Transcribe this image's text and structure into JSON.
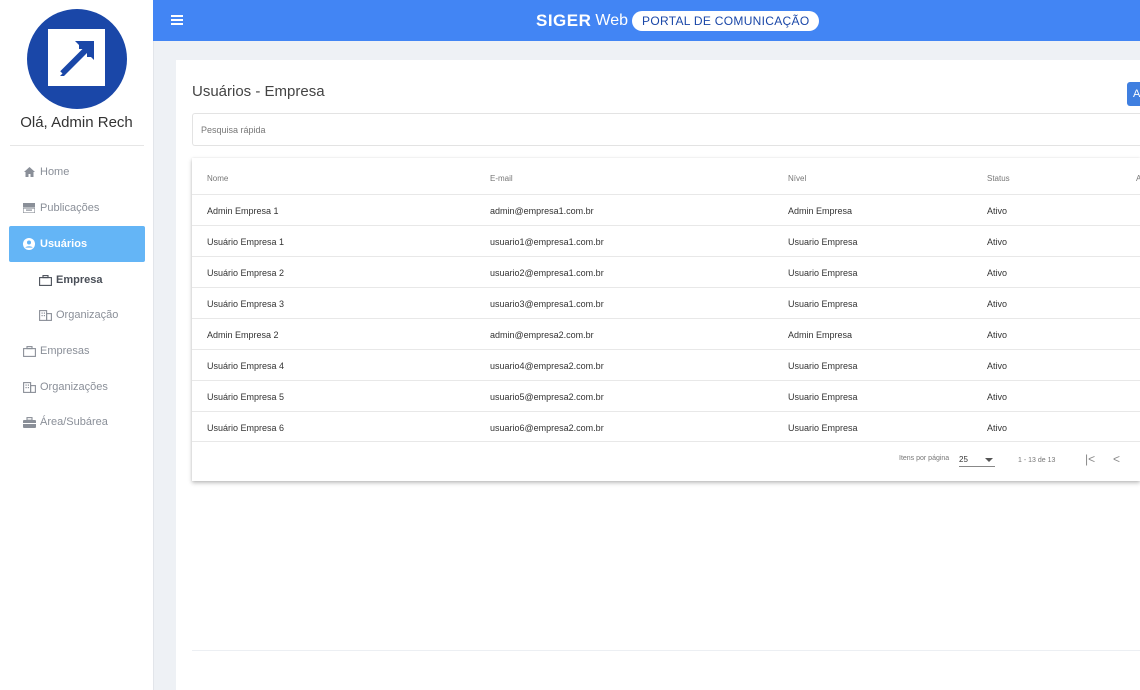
{
  "sidebar": {
    "greeting": "Olá, Admin Rech",
    "items": [
      {
        "label": "Home",
        "icon": "home-icon"
      },
      {
        "label": "Publicações",
        "icon": "publications-icon"
      },
      {
        "label": "Usuários",
        "icon": "user-circle-icon"
      },
      {
        "label": "Empresa",
        "icon": "briefcase-icon"
      },
      {
        "label": "Organização",
        "icon": "building-icon"
      },
      {
        "label": "Empresas",
        "icon": "briefcase-icon"
      },
      {
        "label": "Organizações",
        "icon": "building-icon"
      },
      {
        "label": "Área/Subárea",
        "icon": "toolbox-icon"
      }
    ]
  },
  "header": {
    "brand_bold": "SIGER",
    "brand_web": "Web",
    "brand_portal": "PORTAL DE COMUNICAÇÃO"
  },
  "main": {
    "title": "Usuários - Empresa",
    "add_button_label": "A",
    "search_placeholder": "Pesquisa rápida",
    "table": {
      "columns": [
        "Nome",
        "E-mail",
        "Nível",
        "Status",
        "A"
      ],
      "rows": [
        {
          "nome": "Admin Empresa 1",
          "email": "admin@empresa1.com.br",
          "nivel": "Admin Empresa",
          "status": "Ativo"
        },
        {
          "nome": "Usuário Empresa 1",
          "email": "usuario1@empresa1.com.br",
          "nivel": "Usuario Empresa",
          "status": "Ativo"
        },
        {
          "nome": "Usuário Empresa 2",
          "email": "usuario2@empresa1.com.br",
          "nivel": "Usuario Empresa",
          "status": "Ativo"
        },
        {
          "nome": "Usuário Empresa 3",
          "email": "usuario3@empresa1.com.br",
          "nivel": "Usuario Empresa",
          "status": "Ativo"
        },
        {
          "nome": "Admin Empresa 2",
          "email": "admin@empresa2.com.br",
          "nivel": "Admin Empresa",
          "status": "Ativo"
        },
        {
          "nome": "Usuário Empresa 4",
          "email": "usuario4@empresa2.com.br",
          "nivel": "Usuario Empresa",
          "status": "Ativo"
        },
        {
          "nome": "Usuário Empresa 5",
          "email": "usuario5@empresa2.com.br",
          "nivel": "Usuario Empresa",
          "status": "Ativo"
        },
        {
          "nome": "Usuário Empresa 6",
          "email": "usuario6@empresa2.com.br",
          "nivel": "Usuario Empresa",
          "status": "Ativo"
        }
      ]
    },
    "paginator": {
      "items_per_page_label": "Itens por página",
      "page_size": "25",
      "range": "1 - 13 de 13",
      "first_label": "|<",
      "prev_label": "<"
    }
  },
  "colors": {
    "topbar": "#4285f4",
    "logo": "#1a47a8",
    "active_nav": "#64b5f6"
  }
}
